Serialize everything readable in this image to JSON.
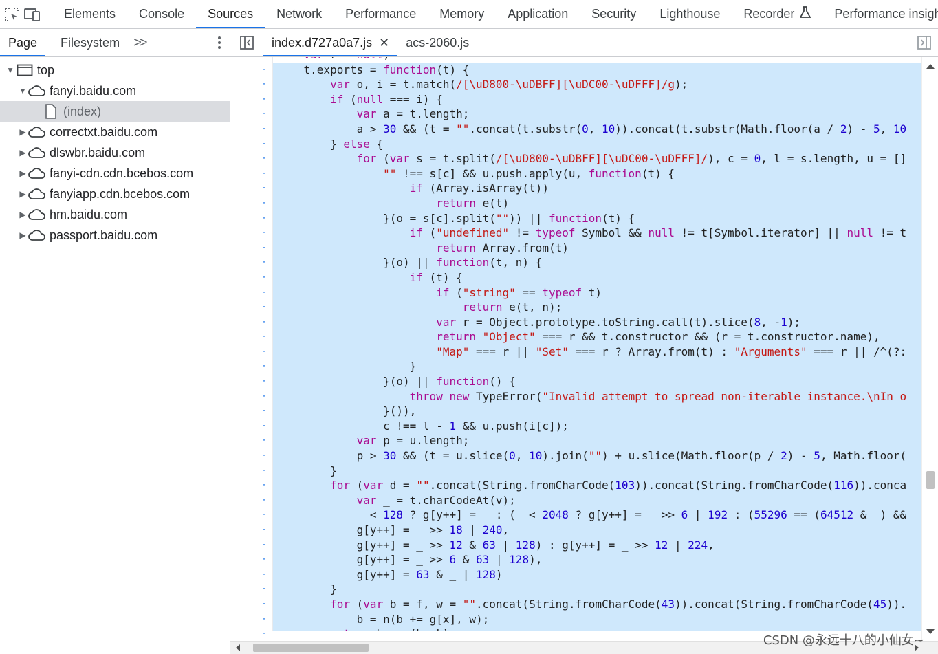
{
  "toolbar": {
    "inspect_icon": "inspect-element-icon",
    "device_icon": "device-toolbar-icon",
    "tabs": [
      {
        "label": "Elements"
      },
      {
        "label": "Console"
      },
      {
        "label": "Sources"
      },
      {
        "label": "Network"
      },
      {
        "label": "Performance"
      },
      {
        "label": "Memory"
      },
      {
        "label": "Application"
      },
      {
        "label": "Security"
      },
      {
        "label": "Lighthouse"
      },
      {
        "label": "Recorder"
      },
      {
        "label": "Performance insights"
      }
    ],
    "active_tab": "Sources",
    "accent_color": "#1a73e8"
  },
  "navigator": {
    "tabs": [
      {
        "label": "Page"
      },
      {
        "label": "Filesystem"
      }
    ],
    "more_label": ">>",
    "tree": [
      {
        "label": "top",
        "icon": "frame-icon",
        "expanded": true
      },
      {
        "label": "fanyi.baidu.com",
        "icon": "cloud-icon",
        "expanded": true
      },
      {
        "label": "(index)",
        "icon": "document-icon",
        "selected": true
      },
      {
        "label": "correctxt.baidu.com",
        "icon": "cloud-icon"
      },
      {
        "label": "dlswbr.baidu.com",
        "icon": "cloud-icon"
      },
      {
        "label": "fanyi-cdn.cdn.bcebos.com",
        "icon": "cloud-icon"
      },
      {
        "label": "fanyiapp.cdn.bcebos.com",
        "icon": "cloud-icon"
      },
      {
        "label": "hm.baidu.com",
        "icon": "cloud-icon"
      },
      {
        "label": "passport.baidu.com",
        "icon": "cloud-icon"
      }
    ]
  },
  "editor": {
    "files": [
      {
        "label": "index.d727a0a7.js",
        "active": true
      },
      {
        "label": "acs-2060.js"
      }
    ],
    "gutter_mark": "-",
    "code_lines": [
      "    var r = null;",
      "    t.exports = function(t) {",
      "        var o, i = t.match(/[\\uD800-\\uDBFF][\\uDC00-\\uDFFF]/g);",
      "        if (null === i) {",
      "            var a = t.length;",
      "            a > 30 && (t = \"\".concat(t.substr(0, 10)).concat(t.substr(Math.floor(a / 2) - 5, 10",
      "        } else {",
      "            for (var s = t.split(/[\\uD800-\\uDBFF][\\uDC00-\\uDFFF]/), c = 0, l = s.length, u = []",
      "                \"\" !== s[c] && u.push.apply(u, function(t) {",
      "                    if (Array.isArray(t))",
      "                        return e(t)",
      "                }(o = s[c].split(\"\")) || function(t) {",
      "                    if (\"undefined\" != typeof Symbol && null != t[Symbol.iterator] || null != t",
      "                        return Array.from(t)",
      "                }(o) || function(t, n) {",
      "                    if (t) {",
      "                        if (\"string\" == typeof t)",
      "                            return e(t, n);",
      "                        var r = Object.prototype.toString.call(t).slice(8, -1);",
      "                        return \"Object\" === r && t.constructor && (r = t.constructor.name),",
      "                        \"Map\" === r || \"Set\" === r ? Array.from(t) : \"Arguments\" === r || /^(?:",
      "                    }",
      "                }(o) || function() {",
      "                    throw new TypeError(\"Invalid attempt to spread non-iterable instance.\\nIn o",
      "                }()),",
      "                c !== l - 1 && u.push(i[c]);",
      "            var p = u.length;",
      "            p > 30 && (t = u.slice(0, 10).join(\"\") + u.slice(Math.floor(p / 2) - 5, Math.floor(",
      "        }",
      "        for (var d = \"\".concat(String.fromCharCode(103)).concat(String.fromCharCode(116)).conca",
      "            var _ = t.charCodeAt(v);",
      "            _ < 128 ? g[y++] = _ : (_ < 2048 ? g[y++] = _ >> 6 | 192 : (55296 == (64512 & _) &&",
      "            g[y++] = _ >> 18 | 240,",
      "            g[y++] = _ >> 12 & 63 | 128) : g[y++] = _ >> 12 | 224,",
      "            g[y++] = _ >> 6 & 63 | 128),",
      "            g[y++] = 63 & _ | 128)",
      "        }",
      "        for (var b = f, w = \"\".concat(String.fromCharCode(43)).concat(String.fromCharCode(45)).",
      "            b = n(b += g[x], w);",
      "        return b = n(b, k),"
    ],
    "highlight_color": "#cfe8fc"
  },
  "watermark": "CSDN @永远十八的小仙女~"
}
